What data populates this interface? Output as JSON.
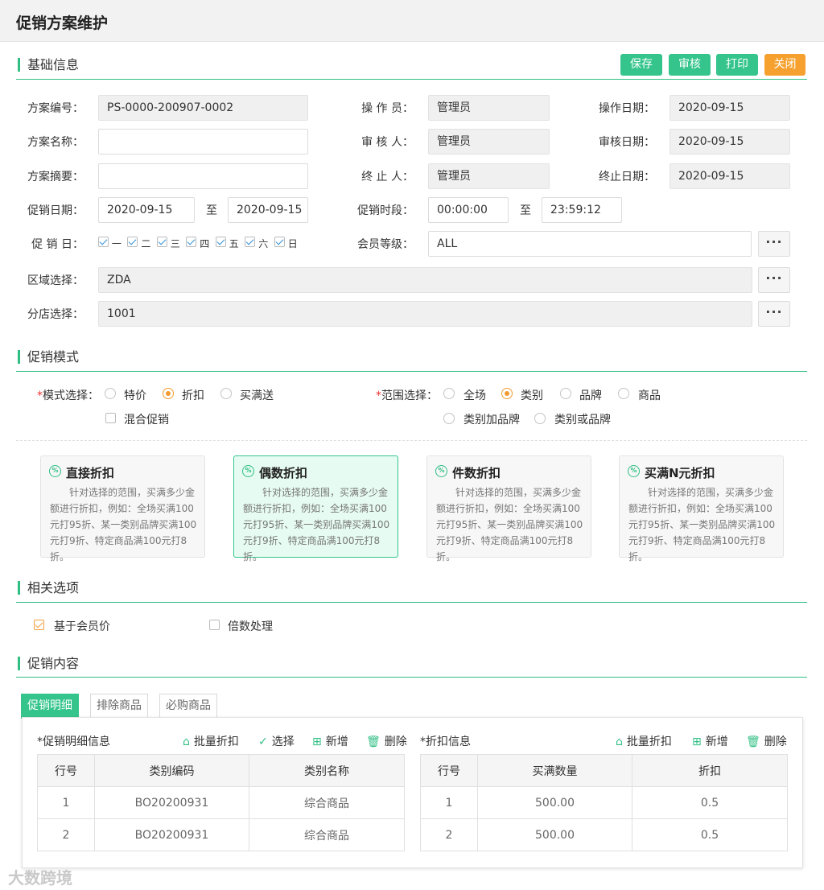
{
  "page_title": "促销方案维护",
  "sections": {
    "basic": "基础信息",
    "mode": "促销模式",
    "options": "相关选项",
    "content": "促销内容"
  },
  "toolbar": {
    "save": "保存",
    "audit": "审核",
    "print": "打印",
    "close": "关闭"
  },
  "form": {
    "plan_no_label": "方案编号：",
    "plan_no": "PS-0000-200907-0002",
    "operator_label": "操 作 员：",
    "operator": "管理员",
    "op_date_label": "操作日期：",
    "op_date": "2020-09-15",
    "plan_name_label": "方案名称：",
    "plan_name": "",
    "auditor_label": "审 核 人：",
    "auditor": "管理员",
    "audit_date_label": "审核日期：",
    "audit_date": "2020-09-15",
    "summary_label": "方案摘要：",
    "summary": "",
    "terminator_label": "终 止 人：",
    "terminator": "管理员",
    "end_date_label": "终止日期：",
    "end_date": "2020-09-15",
    "promo_date_label": "促销日期：",
    "promo_date_from": "2020-09-15",
    "to": "至",
    "promo_date_to": "2020-09-15",
    "promo_time_label": "促销时段：",
    "promo_time_from": "00:00:00",
    "promo_time_to": "23:59:12",
    "promo_day_label": "促 销 日：",
    "days": [
      "一",
      "二",
      "三",
      "四",
      "五",
      "六",
      "日"
    ],
    "member_level_label": "会员等级：",
    "member_level": "ALL",
    "region_label": "区域选择：",
    "region": "ZDA",
    "store_label": "分店选择：",
    "store": "1001",
    "more": "···"
  },
  "mode": {
    "required": "*",
    "mode_label": "模式选择：",
    "mode_options": [
      "特价",
      "折扣",
      "买满送"
    ],
    "mode_selected": "折扣",
    "mixed": "混合促销",
    "scope_label": "范围选择：",
    "scope_options": [
      "全场",
      "类别",
      "品牌",
      "商品",
      "类别加品牌",
      "类别或品牌"
    ],
    "scope_selected": "类别",
    "icon_text": "%"
  },
  "cards": [
    {
      "title": "直接折扣",
      "desc": "针对选择的范围，买满多少金额进行折扣，例如：全场买满100元打95折、某一类别品牌买满100元打9折、特定商品满100元打8折。"
    },
    {
      "title": "偶数折扣",
      "desc": "针对选择的范围，买满多少金额进行折扣，例如：全场买满100元打95折、某一类别品牌买满100元打9折、特定商品满100元打8折。"
    },
    {
      "title": "件数折扣",
      "desc": "针对选择的范围，买满多少金额进行折扣，例如：全场买满100元打95折、某一类别品牌买满100元打9折、特定商品满100元打8折。"
    },
    {
      "title": "买满N元折扣",
      "desc": "针对选择的范围，买满多少金额进行折扣，例如：全场买满100元打95折、某一类别品牌买满100元打9折、特定商品满100元打8折。"
    }
  ],
  "options": {
    "member_price": "基于会员价",
    "multiple": "倍数处理"
  },
  "tabs": [
    "促销明细",
    "排除商品",
    "必购商品"
  ],
  "left_panel": {
    "title": "*促销明细信息",
    "actions": [
      "批量折扣",
      "选择",
      "新增",
      "删除"
    ],
    "columns": [
      "行号",
      "类别编码",
      "类别名称"
    ],
    "rows": [
      [
        "1",
        "BO20200931",
        "综合商品"
      ],
      [
        "2",
        "BO20200931",
        "综合商品"
      ]
    ]
  },
  "right_panel": {
    "title": "*折扣信息",
    "actions": [
      "批量折扣",
      "新增",
      "删除"
    ],
    "columns": [
      "行号",
      "买满数量",
      "折扣"
    ],
    "rows": [
      [
        "1",
        "500.00",
        "0.5"
      ],
      [
        "2",
        "500.00",
        "0.5"
      ]
    ]
  },
  "watermark": "大数跨境",
  "colors": {
    "accent": "#35c58c",
    "warning": "#f6a12f",
    "radio": "#f29b30"
  }
}
